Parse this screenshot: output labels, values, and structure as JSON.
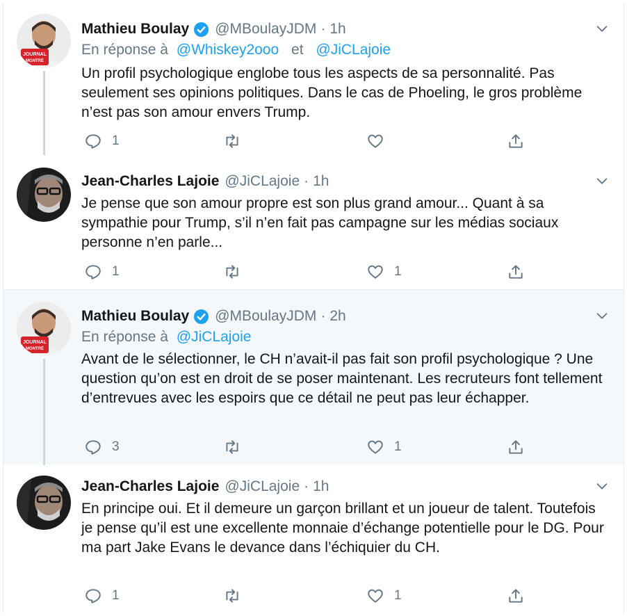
{
  "tweets": [
    {
      "name": "Mathieu Boulay",
      "verified": true,
      "handle": "@MBoulayJDM",
      "dot": "·",
      "time": "1h",
      "reply_prefix": "En réponse à",
      "reply_mentions": [
        "@Whiskey2ooo",
        "@JiCLajoie"
      ],
      "reply_and": "et",
      "text": "Un profil psychologique englobe tous les aspects de sa personnalité. Pas seulement ses opinions politiques. Dans le cas de Phoeling, le gros problème n’est pas son amour envers Trump.",
      "reply_count": "1",
      "retweet_count": "",
      "like_count": "",
      "avatar_logo": "LE JOURNAL DE MONTRÉAL"
    },
    {
      "name": "Jean-Charles Lajoie",
      "verified": false,
      "handle": "@JiCLajoie",
      "dot": "·",
      "time": "1h",
      "text": "Je pense que son amour propre est son plus grand amour... Quant à sa sympathie pour Trump, s’il n’en fait pas campagne sur les médias sociaux personne n’en parle...",
      "reply_count": "1",
      "retweet_count": "",
      "like_count": "1"
    },
    {
      "name": "Mathieu Boulay",
      "verified": true,
      "handle": "@MBoulayJDM",
      "dot": "·",
      "time": "2h",
      "reply_prefix": "En réponse à",
      "reply_mentions": [
        "@JiCLajoie"
      ],
      "text": "Avant de le sélectionner, le CH n’avait-il pas fait son profil psychologique ? Une question qu’on est en droit de se poser maintenant. Les recruteurs font tellement d’entrevues avec les espoirs que ce détail ne peut pas leur échapper.",
      "reply_count": "3",
      "retweet_count": "",
      "like_count": "1",
      "avatar_logo": "LE JOURNAL DE MONTRÉAL"
    },
    {
      "name": "Jean-Charles Lajoie",
      "verified": false,
      "handle": "@JiCLajoie",
      "dot": "·",
      "time": "1h",
      "text": "En principe oui. Et il demeure un garçon brillant et un joueur de talent. Toutefois je pense qu’il est une excellente monnaie d’échange potentielle pour le DG. Pour ma part Jake Evans le devance dans l’échiquier du CH.",
      "reply_count": "1",
      "retweet_count": "",
      "like_count": "1"
    }
  ],
  "icons": {
    "reply": "reply-icon",
    "retweet": "retweet-icon",
    "like": "like-icon",
    "share": "share-icon",
    "verified": "verified-badge-icon",
    "more": "chevron-down-icon"
  },
  "colors": {
    "text": "#14171a",
    "secondary": "#657786",
    "accent": "#1da1f2",
    "highlight_bg": "#f5f8fa",
    "border": "#e6ecf0",
    "thread_line": "#ccd6dd"
  }
}
